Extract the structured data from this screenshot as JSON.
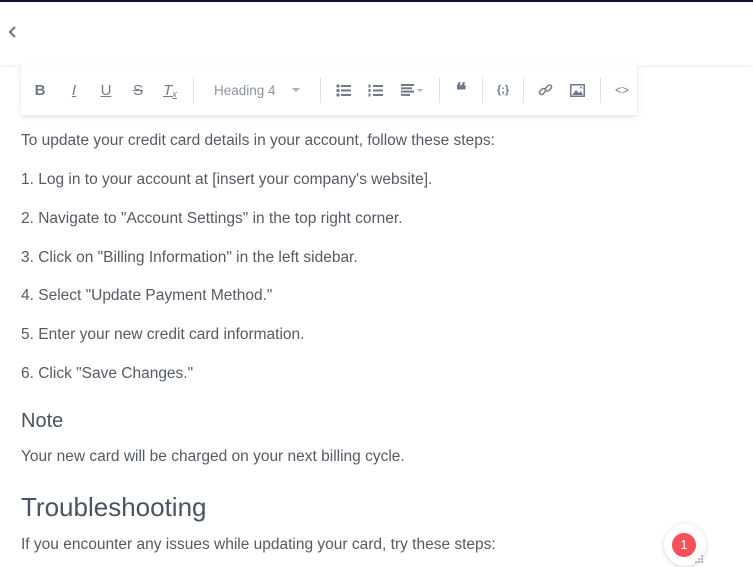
{
  "header": {
    "back_label": "‹"
  },
  "toolbar": {
    "bold": "B",
    "italic": "I",
    "underline": "U",
    "strike": "S",
    "clear": "T",
    "heading_value": "Heading 4",
    "quote": "❝",
    "code": "{;}",
    "source": "<>"
  },
  "content": {
    "intro": "To update your credit card details in your account, follow these steps:",
    "steps": [
      "1. Log in to your account at [insert your company's website].",
      "2. Navigate to \"Account Settings\" in the top right corner.",
      "3. Click on \"Billing Information\" in the left sidebar.",
      "4. Select \"Update Payment Method.\"",
      "5. Enter your new credit card information.",
      "6. Click \"Save Changes.\""
    ],
    "note_heading": "Note",
    "note_text": "Your new card will be charged on your next billing cycle.",
    "troubleshooting_heading": "Troubleshooting",
    "troubleshooting_text": "If you encounter any issues while updating your card, try these steps:"
  },
  "notification": {
    "count": "1",
    "color": "#f2515a"
  }
}
